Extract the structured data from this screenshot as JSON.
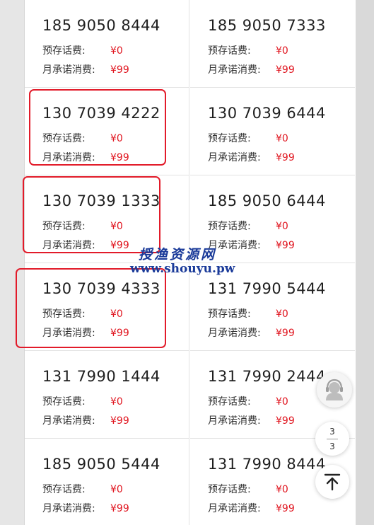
{
  "labels": {
    "prepaid": "预存话费:",
    "monthly": "月承诺消费:"
  },
  "listings": [
    {
      "number": "185 9050 8444",
      "prepaid": "¥0",
      "monthly": "¥99"
    },
    {
      "number": "185 9050 7333",
      "prepaid": "¥0",
      "monthly": "¥99"
    },
    {
      "number": "130 7039 4222",
      "prepaid": "¥0",
      "monthly": "¥99"
    },
    {
      "number": "130 7039 6444",
      "prepaid": "¥0",
      "monthly": "¥99"
    },
    {
      "number": "130 7039 1333",
      "prepaid": "¥0",
      "monthly": "¥99"
    },
    {
      "number": "185 9050 6444",
      "prepaid": "¥0",
      "monthly": "¥99"
    },
    {
      "number": "130 7039 4333",
      "prepaid": "¥0",
      "monthly": "¥99"
    },
    {
      "number": "131 7990 5444",
      "prepaid": "¥0",
      "monthly": "¥99"
    },
    {
      "number": "131 7990 1444",
      "prepaid": "¥0",
      "monthly": "¥99"
    },
    {
      "number": "131 7990 2444",
      "prepaid": "¥0",
      "monthly": "¥99"
    },
    {
      "number": "185 9050 5444",
      "prepaid": "¥0",
      "monthly": "¥99"
    },
    {
      "number": "131 7990 8444",
      "prepaid": "¥0",
      "monthly": "¥99"
    }
  ],
  "watermark": {
    "site_name": "授渔资源网",
    "url": "www.shouyu.pw"
  },
  "pager": {
    "current": "3",
    "total": "3"
  },
  "icons": {
    "customer_service": "customer-service-icon",
    "back_to_top": "back-to-top-icon"
  },
  "colors": {
    "price": "#e0141e",
    "highlight": "#e21b2a",
    "watermark": "#1a3a99"
  }
}
